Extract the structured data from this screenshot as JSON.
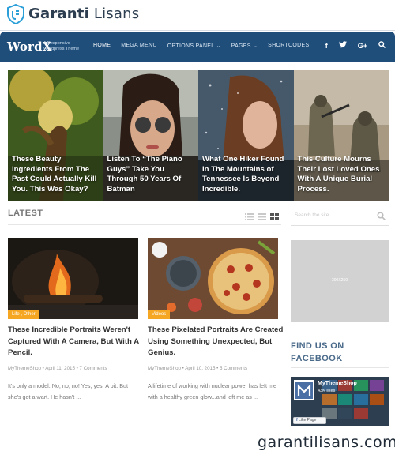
{
  "brand": {
    "name_bold": "Garanti",
    "name_rest": " Lisans",
    "watermark": "garantilisans.com"
  },
  "nav": {
    "logo": "WordX",
    "tagline": "A Responsive Wordpress Theme",
    "items": [
      {
        "label": "HOME",
        "active": true
      },
      {
        "label": "MEGA MENU",
        "active": false
      },
      {
        "label": "OPTIONS PANEL ⌄",
        "active": false
      },
      {
        "label": "PAGES ⌄",
        "active": false
      },
      {
        "label": "SHORTCODES",
        "active": false
      }
    ],
    "social": [
      "f",
      "t",
      "G+",
      "search"
    ]
  },
  "featured": [
    {
      "title": "These Beauty Ingredients From The Past Could Actually Kill You. This Was Okay?",
      "image": "forest-sculpture"
    },
    {
      "title": "Listen To “The Piano Guys” Take You Through 50 Years Of Batman",
      "image": "woman-sunglasses"
    },
    {
      "title": "What One Hiker Found In The Mountains of Tennessee Is Beyond Incredible.",
      "image": "woman-snow"
    },
    {
      "title": "This Culture Mourns Their Lost Loved Ones With A Unique Burial Process.",
      "image": "soldiers"
    }
  ],
  "latest": {
    "label": "LATEST"
  },
  "posts": [
    {
      "category": "Life , Other",
      "title": "These Incredible Portraits Weren't Captured With A Camera, But With A Pencil.",
      "meta": "MyThemeShop • April 11, 2015 • 7 Comments",
      "excerpt": "It's only a model. No, no, no! Yes, yes. A bit. But she's got a wart. He hasn't ...",
      "image": "campfire"
    },
    {
      "category": "Videos",
      "title": "These Pixelated Portraits Are Created Using Something Unexpected, But Genius.",
      "meta": "MyThemeShop • April 10, 2015 • 5 Comments",
      "excerpt": "A lifetime of working with nuclear power has left me with a healthy green glow...and left me as ...",
      "image": "pizza"
    }
  ],
  "sidebar": {
    "search_placeholder": "Search the site",
    "ad_label": "300X250",
    "facebook_heading_line1": "FIND US ON",
    "facebook_heading_line2": "FACEBOOK",
    "fb_page_name": "MyThemeShop",
    "fb_likes": "43K likes",
    "fb_button": "Like Page"
  },
  "colors": {
    "nav_bg": "#1f4e7b",
    "accent": "#f5a623",
    "heading": "#4a6a8a"
  }
}
